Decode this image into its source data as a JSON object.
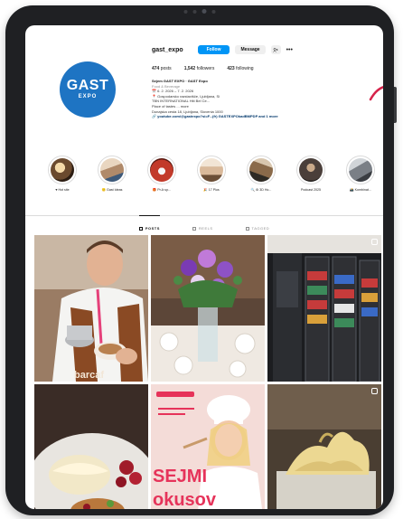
{
  "profile": {
    "username": "gast_expo",
    "follow_label": "Follow",
    "message_label": "Message",
    "more_label": "•••",
    "avatar_text_line1": "GAST",
    "avatar_text_line2": "EXPO",
    "stats": [
      {
        "value": "474",
        "label": "posts"
      },
      {
        "value": "1,542",
        "label": "followers"
      },
      {
        "value": "423",
        "label": "following"
      }
    ],
    "bio": {
      "name": "Sejem GAST EXPO · GAST Expo",
      "category": "Food & Beverage",
      "line1": "📅 6. 2. 2026 – 7. 2. 2026",
      "line2": "📍 Gospodarsko razstavišče, Ljubljana, Si",
      "line3": "TBN INTERNATIONAL Hiti Bel Ce...",
      "line4": "Place of tastes ... more",
      "line5": "Dunajska cesta 18, Ljubljana, Slovenia 1000",
      "link": "🔗 youtube.com/@gastexpo?si=F...(fr) GASTEXPOkadBMPDP and 1 more"
    }
  },
  "highlights": [
    {
      "label": "♥ Hot site",
      "color": "#6b4a2e"
    },
    {
      "label": "🙂 Gast Ideas",
      "color": "#b08a6a"
    },
    {
      "label": "🎁 Pr.A·up...",
      "color": "#c23a2a"
    },
    {
      "label": "🎉 17 Plus",
      "color": "#d9b99a"
    },
    {
      "label": "🔍 ⚙ 3D Ho...",
      "color": "#8a6a4a"
    },
    {
      "label": "Podcast 2025",
      "color": "#4a3f3a"
    },
    {
      "label": "📸 Kombinat...",
      "color": "#7a7f86"
    }
  ],
  "tabs": [
    {
      "label": "POSTS",
      "active": true
    },
    {
      "label": "REELS",
      "active": false
    },
    {
      "label": "TAGGED",
      "active": false
    }
  ],
  "posts": [
    {
      "subject": "barista-latte-art",
      "text": "barcaf"
    },
    {
      "subject": "flower-arrangement-table",
      "text": ""
    },
    {
      "subject": "beverage-fridges",
      "text": ""
    },
    {
      "subject": "dessert-crumble",
      "text": ""
    },
    {
      "subject": "chef-poster",
      "text_line1": "SEJMI",
      "text_line2": "okusov"
    },
    {
      "subject": "gelato-tub",
      "text": ""
    }
  ],
  "colors": {
    "accent": "#0095f6",
    "avatar_blue": "#1e74c3",
    "device_frame": "#1f2023",
    "curve_red": "#d6234a"
  }
}
